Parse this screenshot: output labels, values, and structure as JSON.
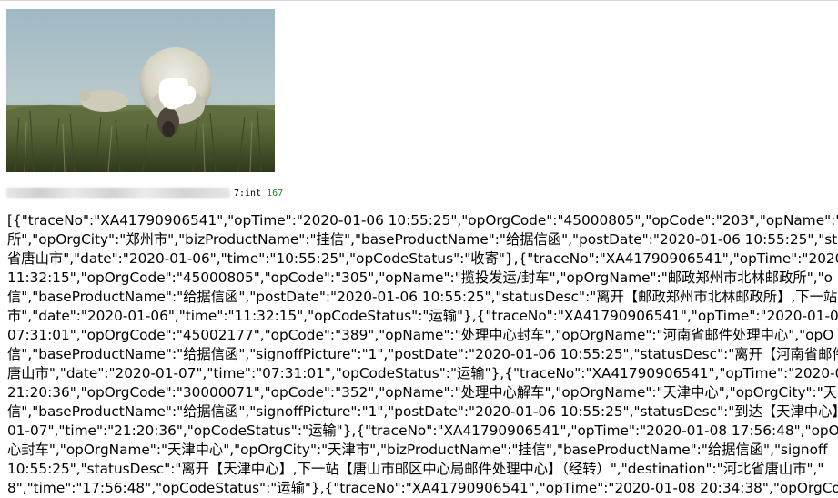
{
  "result": {
    "type_label": "7:int",
    "count": "167"
  },
  "response_lines": [
    "[{\"traceNo\":\"XA41790906541\",\"opTime\":\"2020-01-06 10:55:25\",\"opOrgCode\":\"45000805\",\"opCode\":\"203\",\"opName\":\"收",
    "所\",\"opOrgCity\":\"郑州市\",\"bizProductName\":\"挂信\",\"baseProductName\":\"给据信函\",\"postDate\":\"2020-01-06 10:55:25\",\"sta",
    "省唐山市\",\"date\":\"2020-01-06\",\"time\":\"10:55:25\",\"opCodeStatus\":\"收寄\"},{\"traceNo\":\"XA41790906541\",\"opTime\":\"2020-01",
    "11:32:15\",\"opOrgCode\":\"45000805\",\"opCode\":\"305\",\"opName\":\"揽投发运/封车\",\"opOrgName\":\"邮政郑州市北林邮政所\",\"o",
    "信\",\"baseProductName\":\"给据信函\",\"postDate\":\"2020-01-06 10:55:25\",\"statusDesc\":\"离开【邮政郑州市北林邮政所】,下一站",
    "市\",\"date\":\"2020-01-06\",\"time\":\"11:32:15\",\"opCodeStatus\":\"运输\"},{\"traceNo\":\"XA41790906541\",\"opTime\":\"2020-01-07",
    "07:31:01\",\"opOrgCode\":\"45002177\",\"opCode\":\"389\",\"opName\":\"处理中心封车\",\"opOrgName\":\"河南省邮件处理中心\",\"opO",
    "信\",\"baseProductName\":\"给据信函\",\"signoffPicture\":\"1\",\"postDate\":\"2020-01-06 10:55:25\",\"statusDesc\":\"离开【河南省邮件",
    "唐山市\",\"date\":\"2020-01-07\",\"time\":\"07:31:01\",\"opCodeStatus\":\"运输\"},{\"traceNo\":\"XA41790906541\",\"opTime\":\"2020-01-0",
    "21:20:36\",\"opOrgCode\":\"30000071\",\"opCode\":\"352\",\"opName\":\"处理中心解车\",\"opOrgName\":\"天津中心\",\"opOrgCity\":\"天",
    "信\",\"baseProductName\":\"给据信函\",\"signoffPicture\":\"1\",\"postDate\":\"2020-01-06 10:55:25\",\"statusDesc\":\"到达【天津中心】",
    "01-07\",\"time\":\"21:20:36\",\"opCodeStatus\":\"运输\"},{\"traceNo\":\"XA41790906541\",\"opTime\":\"2020-01-08 17:56:48\",\"opOrgC",
    "心封车\",\"opOrgName\":\"天津中心\",\"opOrgCity\":\"天津市\",\"bizProductName\":\"挂信\",\"baseProductName\":\"给据信函\",\"signoff",
    "10:55:25\",\"statusDesc\":\"离开【天津中心】,下一站【唐山市邮区中心局邮件处理中心】（经转）\",\"destination\":\"河北省唐山市\",\"",
    "8\",\"time\":\"17:56:48\",\"opCodeStatus\":\"运输\"},{\"traceNo\":\"XA41790906541\",\"opTime\":\"2020-01-08 20:34:38\",\"opOrgCo"
  ]
}
